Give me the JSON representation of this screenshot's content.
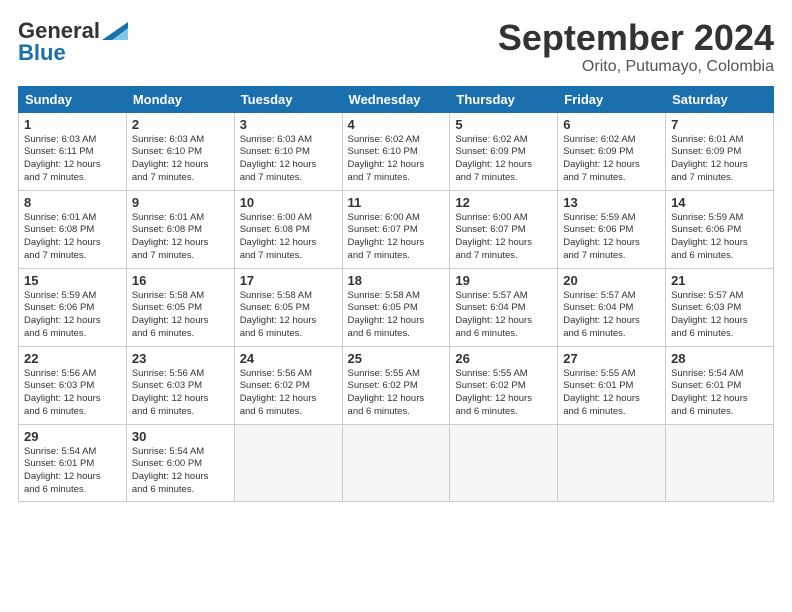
{
  "logo": {
    "line1": "General",
    "line2": "Blue"
  },
  "title": "September 2024",
  "subtitle": "Orito, Putumayo, Colombia",
  "weekdays": [
    "Sunday",
    "Monday",
    "Tuesday",
    "Wednesday",
    "Thursday",
    "Friday",
    "Saturday"
  ],
  "weeks": [
    [
      {
        "day": 1,
        "sunrise": "6:03 AM",
        "sunset": "6:11 PM",
        "daylight": "12 hours and 7 minutes."
      },
      {
        "day": 2,
        "sunrise": "6:03 AM",
        "sunset": "6:10 PM",
        "daylight": "12 hours and 7 minutes."
      },
      {
        "day": 3,
        "sunrise": "6:03 AM",
        "sunset": "6:10 PM",
        "daylight": "12 hours and 7 minutes."
      },
      {
        "day": 4,
        "sunrise": "6:02 AM",
        "sunset": "6:10 PM",
        "daylight": "12 hours and 7 minutes."
      },
      {
        "day": 5,
        "sunrise": "6:02 AM",
        "sunset": "6:09 PM",
        "daylight": "12 hours and 7 minutes."
      },
      {
        "day": 6,
        "sunrise": "6:02 AM",
        "sunset": "6:09 PM",
        "daylight": "12 hours and 7 minutes."
      },
      {
        "day": 7,
        "sunrise": "6:01 AM",
        "sunset": "6:09 PM",
        "daylight": "12 hours and 7 minutes."
      }
    ],
    [
      {
        "day": 8,
        "sunrise": "6:01 AM",
        "sunset": "6:08 PM",
        "daylight": "12 hours and 7 minutes."
      },
      {
        "day": 9,
        "sunrise": "6:01 AM",
        "sunset": "6:08 PM",
        "daylight": "12 hours and 7 minutes."
      },
      {
        "day": 10,
        "sunrise": "6:00 AM",
        "sunset": "6:08 PM",
        "daylight": "12 hours and 7 minutes."
      },
      {
        "day": 11,
        "sunrise": "6:00 AM",
        "sunset": "6:07 PM",
        "daylight": "12 hours and 7 minutes."
      },
      {
        "day": 12,
        "sunrise": "6:00 AM",
        "sunset": "6:07 PM",
        "daylight": "12 hours and 7 minutes."
      },
      {
        "day": 13,
        "sunrise": "5:59 AM",
        "sunset": "6:06 PM",
        "daylight": "12 hours and 7 minutes."
      },
      {
        "day": 14,
        "sunrise": "5:59 AM",
        "sunset": "6:06 PM",
        "daylight": "12 hours and 6 minutes."
      }
    ],
    [
      {
        "day": 15,
        "sunrise": "5:59 AM",
        "sunset": "6:06 PM",
        "daylight": "12 hours and 6 minutes."
      },
      {
        "day": 16,
        "sunrise": "5:58 AM",
        "sunset": "6:05 PM",
        "daylight": "12 hours and 6 minutes."
      },
      {
        "day": 17,
        "sunrise": "5:58 AM",
        "sunset": "6:05 PM",
        "daylight": "12 hours and 6 minutes."
      },
      {
        "day": 18,
        "sunrise": "5:58 AM",
        "sunset": "6:05 PM",
        "daylight": "12 hours and 6 minutes."
      },
      {
        "day": 19,
        "sunrise": "5:57 AM",
        "sunset": "6:04 PM",
        "daylight": "12 hours and 6 minutes."
      },
      {
        "day": 20,
        "sunrise": "5:57 AM",
        "sunset": "6:04 PM",
        "daylight": "12 hours and 6 minutes."
      },
      {
        "day": 21,
        "sunrise": "5:57 AM",
        "sunset": "6:03 PM",
        "daylight": "12 hours and 6 minutes."
      }
    ],
    [
      {
        "day": 22,
        "sunrise": "5:56 AM",
        "sunset": "6:03 PM",
        "daylight": "12 hours and 6 minutes."
      },
      {
        "day": 23,
        "sunrise": "5:56 AM",
        "sunset": "6:03 PM",
        "daylight": "12 hours and 6 minutes."
      },
      {
        "day": 24,
        "sunrise": "5:56 AM",
        "sunset": "6:02 PM",
        "daylight": "12 hours and 6 minutes."
      },
      {
        "day": 25,
        "sunrise": "5:55 AM",
        "sunset": "6:02 PM",
        "daylight": "12 hours and 6 minutes."
      },
      {
        "day": 26,
        "sunrise": "5:55 AM",
        "sunset": "6:02 PM",
        "daylight": "12 hours and 6 minutes."
      },
      {
        "day": 27,
        "sunrise": "5:55 AM",
        "sunset": "6:01 PM",
        "daylight": "12 hours and 6 minutes."
      },
      {
        "day": 28,
        "sunrise": "5:54 AM",
        "sunset": "6:01 PM",
        "daylight": "12 hours and 6 minutes."
      }
    ],
    [
      {
        "day": 29,
        "sunrise": "5:54 AM",
        "sunset": "6:01 PM",
        "daylight": "12 hours and 6 minutes."
      },
      {
        "day": 30,
        "sunrise": "5:54 AM",
        "sunset": "6:00 PM",
        "daylight": "12 hours and 6 minutes."
      },
      null,
      null,
      null,
      null,
      null
    ]
  ],
  "labels": {
    "sunrise": "Sunrise:",
    "sunset": "Sunset:",
    "daylight": "Daylight:"
  }
}
